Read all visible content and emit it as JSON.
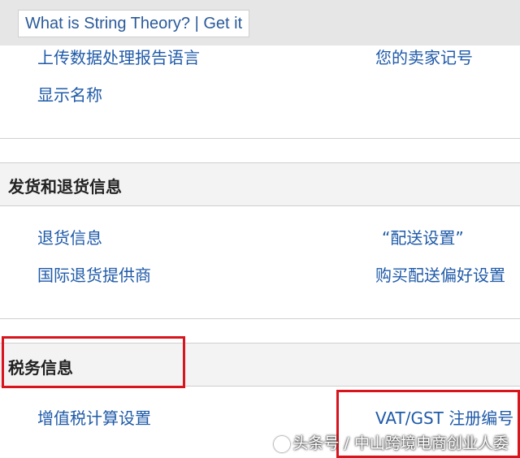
{
  "tooltip": {
    "text": "What is String Theory? | Get it"
  },
  "account_section": {
    "left_links": [
      "上传数据处理报告语言",
      "显示名称"
    ],
    "right_links": [
      "您的卖家记号"
    ]
  },
  "shipping_section": {
    "title": "发货和退货信息",
    "left_links": [
      "退货信息",
      "国际退货提供商"
    ],
    "right_links": [
      "“配送设置”",
      "购买配送偏好设置"
    ]
  },
  "tax_section": {
    "title": "税务信息",
    "left_links": [
      "增值税计算设置"
    ],
    "right_links": [
      "VAT/GST 注册编号"
    ]
  },
  "watermark": {
    "text": "头条号 / 中山跨境电商创业人委"
  },
  "colors": {
    "link": "#1f5aa8",
    "highlight": "#d8141c",
    "section_bg": "#f3f3f3"
  }
}
